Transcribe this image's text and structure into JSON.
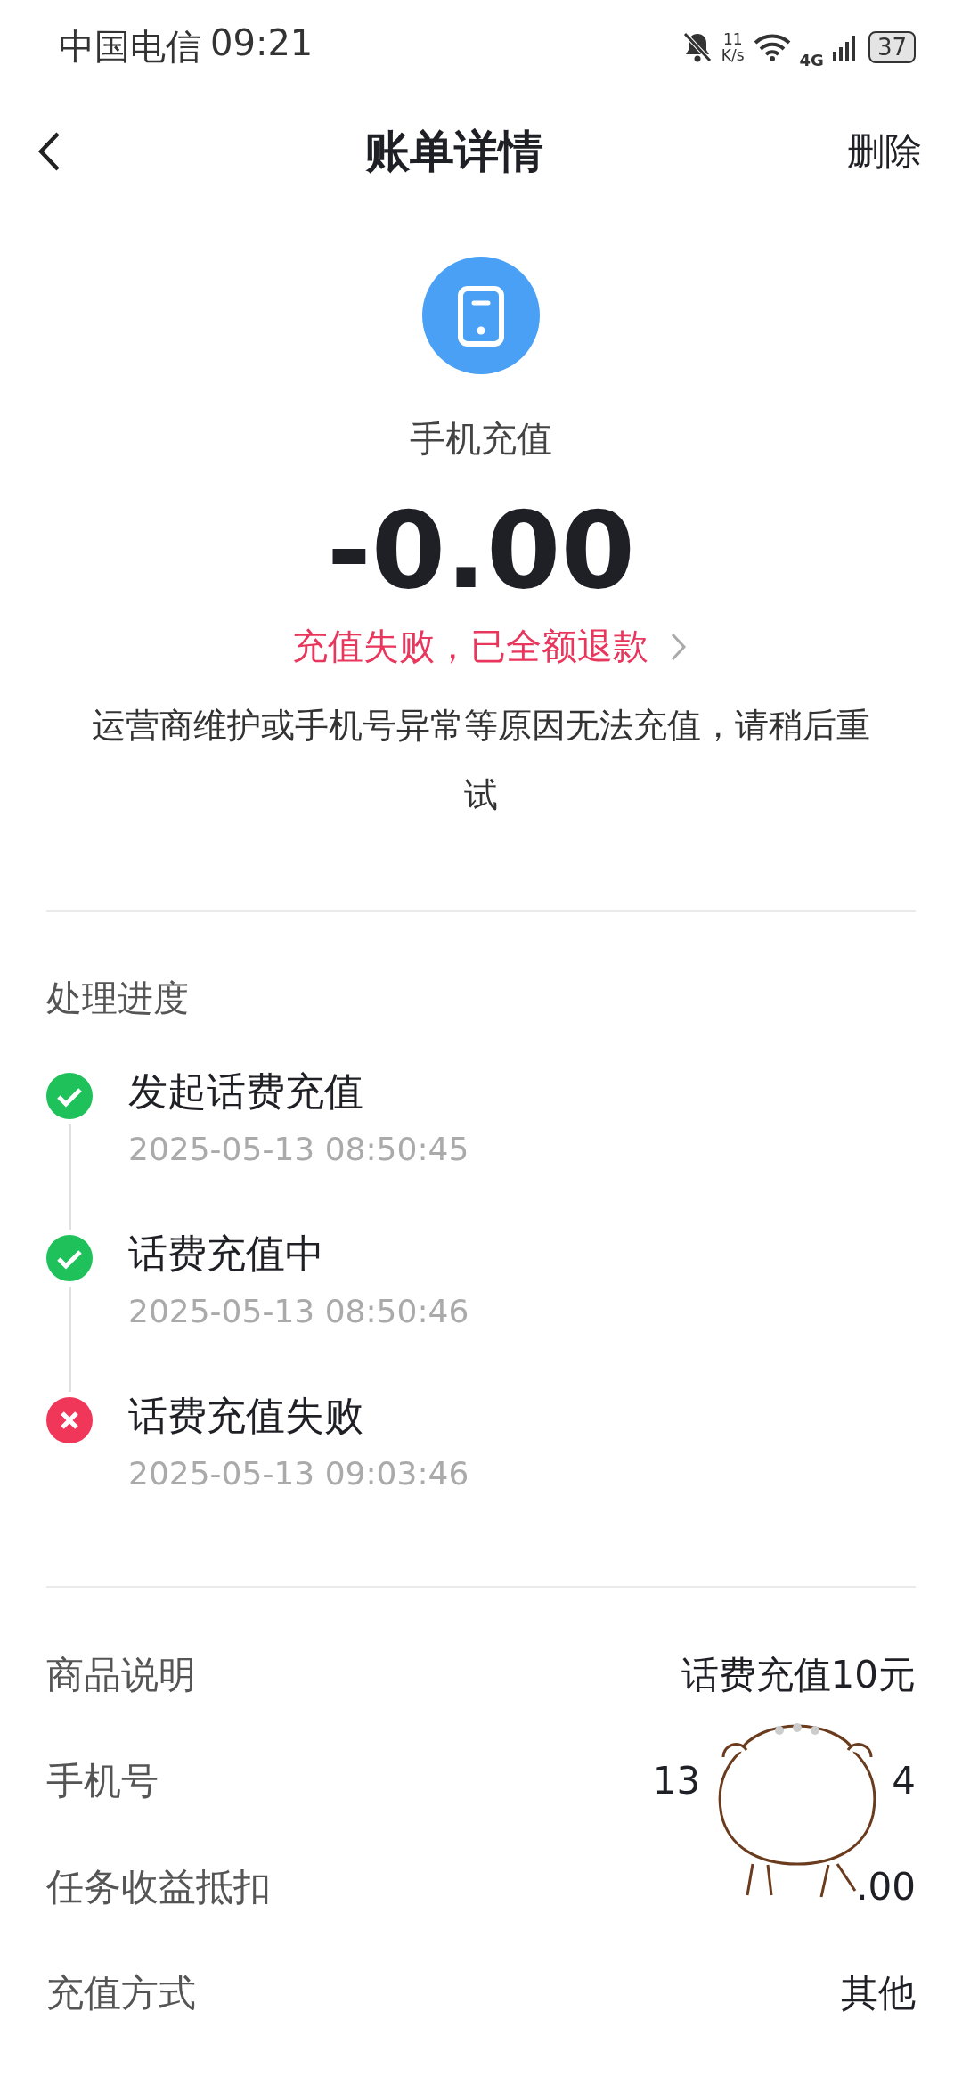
{
  "status_bar": {
    "carrier": "中国电信",
    "time": "09:21",
    "speed_value": "11",
    "speed_unit": "K/s",
    "network": "4G",
    "battery": "37"
  },
  "header": {
    "title": "账单详情",
    "action": "删除"
  },
  "summary": {
    "category": "手机充值",
    "amount": "-0.00",
    "status": "充值失败，已全额退款",
    "note": "运营商维护或手机号异常等原因无法充值，请稍后重试"
  },
  "progress": {
    "title": "处理进度",
    "steps": [
      {
        "label": "发起话费充值",
        "time": "2025-05-13 08:50:45",
        "kind": "done"
      },
      {
        "label": "话费充值中",
        "time": "2025-05-13 08:50:46",
        "kind": "done"
      },
      {
        "label": "话费充值失败",
        "time": "2025-05-13 09:03:46",
        "kind": "failed"
      }
    ]
  },
  "details": [
    {
      "label": "商品说明",
      "values": [
        "话费充值10元"
      ]
    },
    {
      "label": "手机号",
      "values": [
        "13",
        "4"
      ]
    },
    {
      "label": "任务收益抵扣",
      "values": [
        ".00"
      ]
    },
    {
      "label": "充值方式",
      "values": [
        "其他"
      ]
    }
  ]
}
